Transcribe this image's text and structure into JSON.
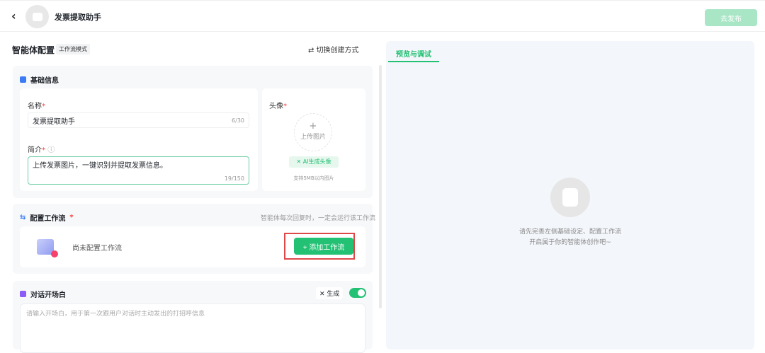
{
  "header": {
    "back_icon": "chevron-left-icon",
    "title": "发票提取助手",
    "publish_label": "去发布"
  },
  "config": {
    "title": "智能体配置",
    "mode_tag": "工作流模式",
    "switch_label": "切换创建方式"
  },
  "basic_info": {
    "title": "基础信息",
    "name_label": "名称",
    "name_value": "发票提取助手",
    "name_count": "6/30",
    "desc_label": "简介",
    "desc_value": "上传发票图片，一键识别并提取发票信息。",
    "desc_count": "19/150",
    "avatar_label": "头像",
    "upload_label": "上传图片",
    "ai_avatar_label": "AI生成头像",
    "upload_hint": "支持5MB以内图片"
  },
  "workflow": {
    "title": "配置工作流",
    "hint": "智能体每次回复时，一定会运行该工作流",
    "empty_text": "尚未配置工作流",
    "add_label": "+ 添加工作流"
  },
  "opening": {
    "title": "对话开场白",
    "generate_label": "生成",
    "toggle_on": true,
    "placeholder": "请输入开场白，用于第一次跟用户对话时主动发出的打招呼信息"
  },
  "preview": {
    "tab_label": "预览与调试",
    "empty_line1": "请先完善左侧基础设定、配置工作流",
    "empty_line2": "开启属于你的智能体创作吧~"
  }
}
